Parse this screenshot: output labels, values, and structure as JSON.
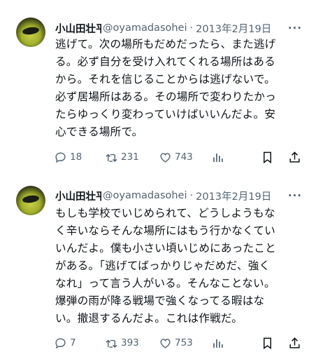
{
  "tweets": [
    {
      "name": "小山田壮平",
      "handle": "@oyamadasohei",
      "date": "2013年2月19日",
      "more": "···",
      "lines": [
        "逃げて。次の場所もだめだったら、また逃げ",
        "る。必ず自分を受け入れてくれる場所はある",
        "から。それを信じることからは逃げないで。",
        "必ず居場所はある。その場所で変わりたかっ",
        "たらゆっくり変わっていけばいいんだよ。安",
        "心できる場所で。"
      ],
      "replies": "18",
      "retweets": "231",
      "likes": "743"
    },
    {
      "name": "小山田壮平",
      "handle": "@oyamadasohei",
      "date": "2013年2月19日",
      "more": "···",
      "lines": [
        "もしも学校でいじめられて、どうしようもな",
        "く辛いならそんな場所にはもう行かなくてい",
        "いんだよ。僕も小さい頃いじめにあったこと",
        "がある。「逃げてばっかりじゃだめだ、強く",
        "なれ」って言う人がいる。そんなことない。",
        "爆弾の雨が降る戦場で強くなってる暇はな",
        "い。撤退するんだよ。これは作戦だ。"
      ],
      "replies": "7",
      "retweets": "393",
      "likes": "753"
    }
  ],
  "icons": [
    "avatar",
    "more-icon",
    "reply-icon",
    "retweet-icon",
    "like-icon",
    "views-icon",
    "bookmark-icon",
    "share-icon"
  ],
  "colors": {
    "text": "#0f1419",
    "secondary": "#536471"
  }
}
